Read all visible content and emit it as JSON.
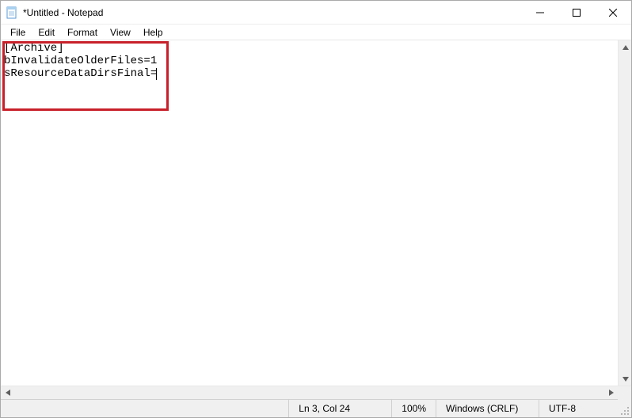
{
  "titlebar": {
    "title": "*Untitled - Notepad"
  },
  "menu": {
    "items": [
      "File",
      "Edit",
      "Format",
      "View",
      "Help"
    ]
  },
  "editor": {
    "lines": [
      "[Archive]",
      "bInvalidateOlderFiles=1",
      "sResourceDataDirsFinal="
    ]
  },
  "statusbar": {
    "position": "Ln 3, Col 24",
    "zoom": "100%",
    "line_ending": "Windows (CRLF)",
    "encoding": "UTF-8"
  },
  "icons": {
    "minimize": "minimize-icon",
    "maximize": "maximize-icon",
    "close": "close-icon",
    "notepad": "notepad-icon"
  }
}
